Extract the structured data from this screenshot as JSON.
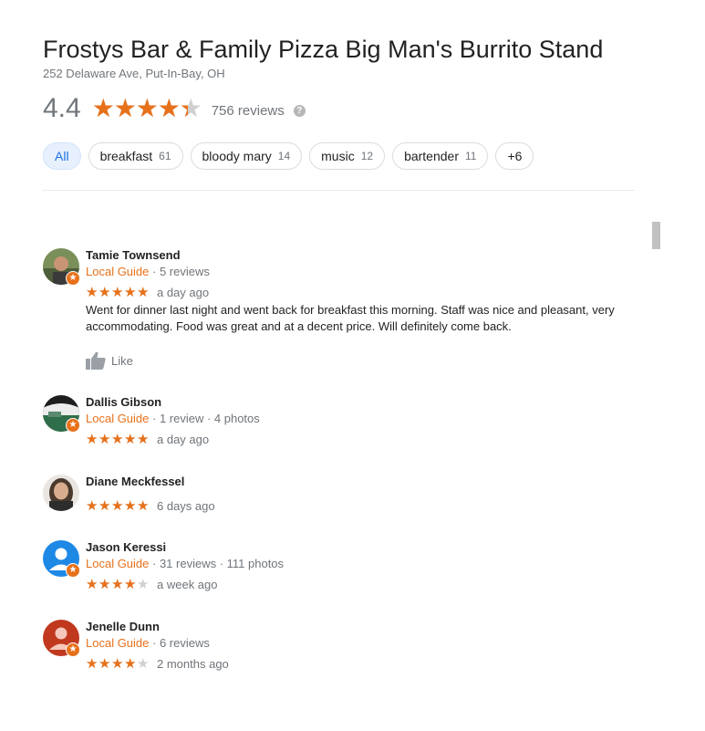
{
  "place": {
    "title": "Frostys Bar & Family Pizza Big Man's Burrito Stand",
    "address": "252 Delaware Ave, Put-In-Bay, OH",
    "rating_text": "4.4",
    "rating": 4.4,
    "review_count": "756 reviews"
  },
  "colors": {
    "accent": "#e7711b",
    "chip_active": "#1a73e8"
  },
  "chips": [
    {
      "label": "All",
      "count": ""
    },
    {
      "label": "breakfast",
      "count": "61"
    },
    {
      "label": "bloody mary",
      "count": "14"
    },
    {
      "label": "music",
      "count": "12"
    },
    {
      "label": "bartender",
      "count": "11"
    },
    {
      "label": "+6",
      "count": ""
    }
  ],
  "reviews": [
    {
      "name": "Tamie Townsend",
      "guide": "Local Guide",
      "stats": " · 5 reviews",
      "stars": 5,
      "when": "a day ago",
      "text": "Went for dinner last night and went back for breakfast this morning. Staff was nice and pleasant, very accommodating. Food was great and at a decent price. Will definitely come back.",
      "like_label": "Like"
    },
    {
      "name": "Dallis Gibson",
      "guide": "Local Guide",
      "stats": " · 1 review · 4 photos",
      "stars": 5,
      "when": "a day ago"
    },
    {
      "name": "Diane Meckfessel",
      "stars": 5,
      "when": "6 days ago"
    },
    {
      "name": "Jason Keressi",
      "guide": "Local Guide",
      "stats": " · 31 reviews · 111 photos",
      "stars": 4,
      "when": "a week ago"
    },
    {
      "name": "Jenelle Dunn",
      "guide": "Local Guide",
      "stats": " · 6 reviews",
      "stars": 4,
      "when": "2 months ago"
    }
  ]
}
